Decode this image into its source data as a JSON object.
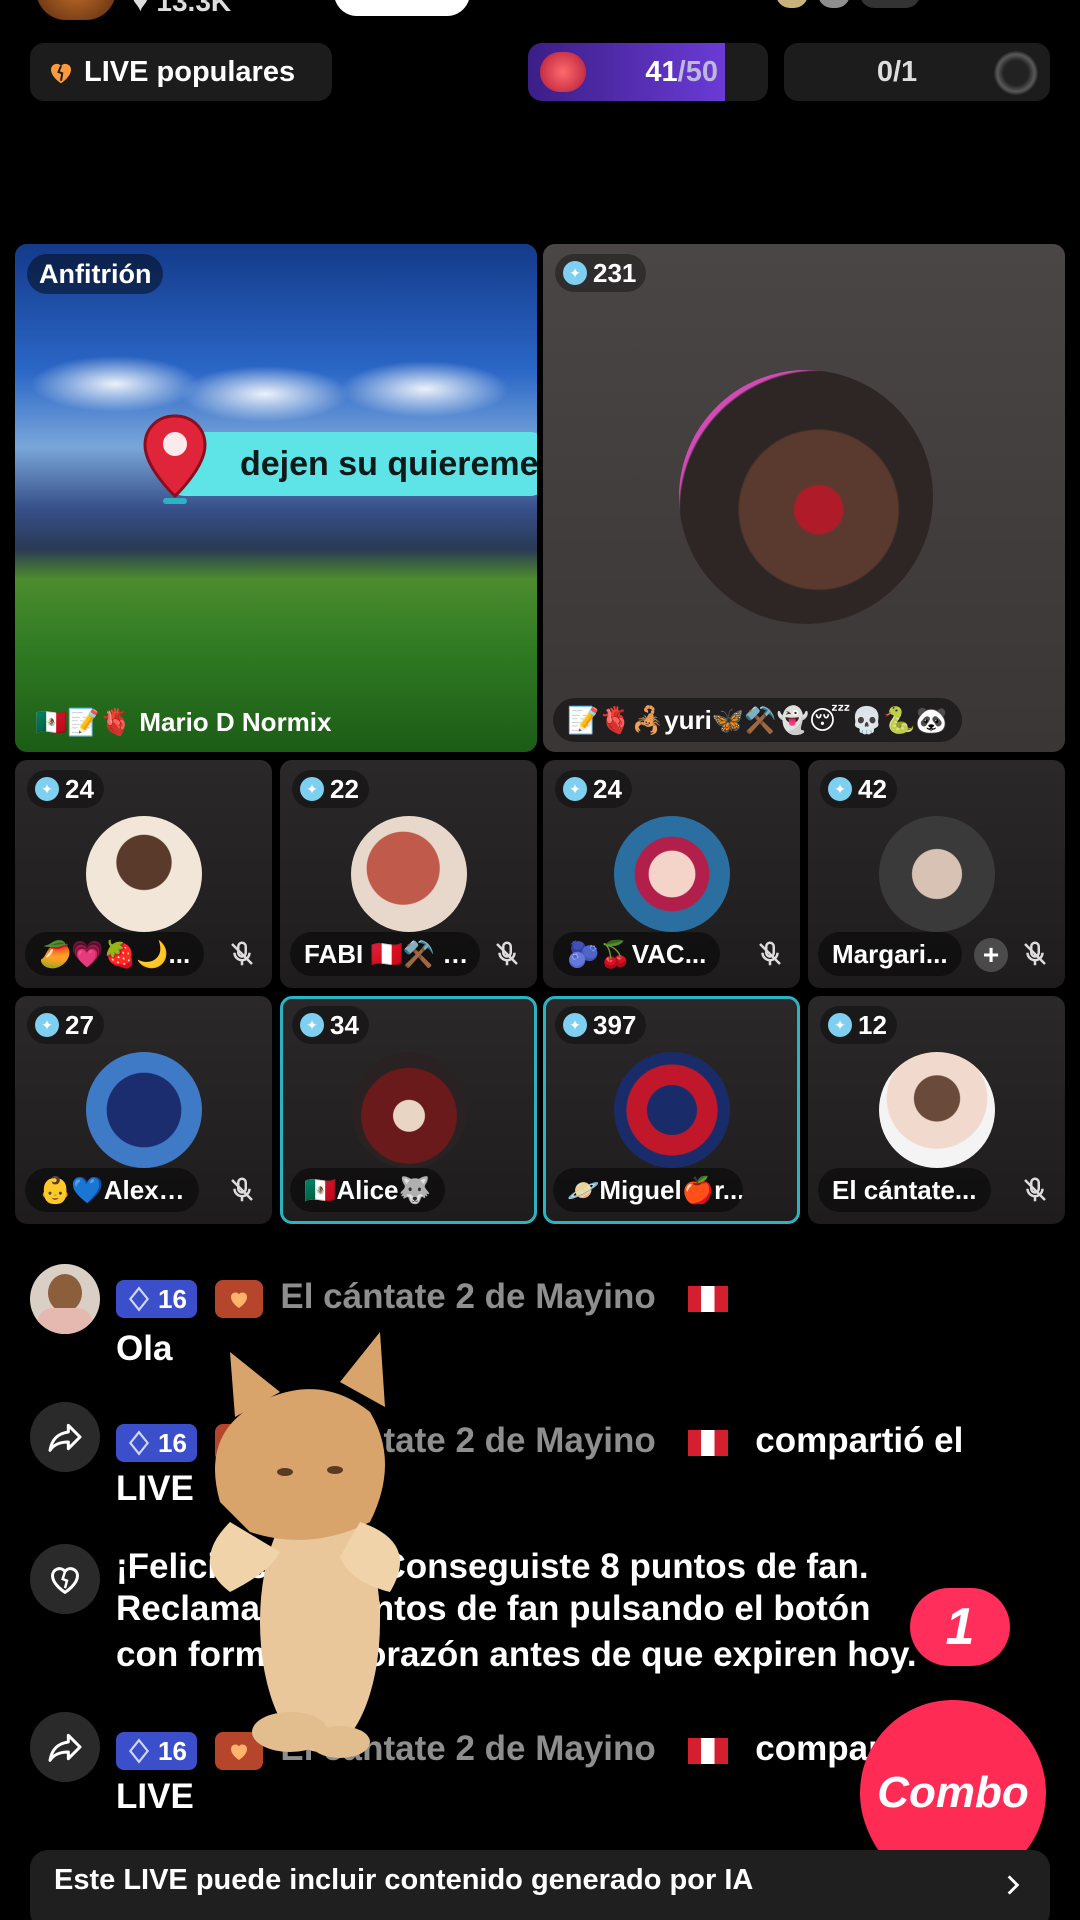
{
  "top": {
    "likes": "13.3K"
  },
  "chips": {
    "live_label": "LIVE populares",
    "score_current": "41",
    "score_total": "/50",
    "score_fraction": 0.82,
    "quest": "0/1"
  },
  "host": {
    "tag": "Anfitrión",
    "banner": "dejen su quiereme",
    "name": "🇲🇽📝🫀 Mario D Normix"
  },
  "feature": {
    "count": "231",
    "name": "📝🫀🦂yuri🦋⚒️👻😴💀🐍🐼"
  },
  "guests": [
    {
      "count": "24",
      "name": "🥭💗🍓🌙...",
      "muted": true
    },
    {
      "count": "22",
      "name": "FABI 🇵🇪⚒️ …",
      "muted": true
    },
    {
      "count": "24",
      "name": "🫐🍒VAC...",
      "muted": true
    },
    {
      "count": "42",
      "name": "Margari...",
      "muted": true,
      "add": true
    },
    {
      "count": "27",
      "name": "👶💙Alex…",
      "muted": true
    },
    {
      "count": "34",
      "name": "🇲🇽Alice🐺",
      "muted": false
    },
    {
      "count": "397",
      "name": "🪐Miguel🍎r...",
      "muted": false
    },
    {
      "count": "12",
      "name": "El cántate...",
      "muted": true
    }
  ],
  "chat": {
    "msg1": {
      "level": "16",
      "user": "El cántate 2 de Mayino",
      "text": "Ola"
    },
    "msg2": {
      "level": "16",
      "user": "El cántate 2 de Mayino",
      "action": "compartió el",
      "cont": "LIVE"
    },
    "msg3": {
      "line1": "¡Felicitaciones! Conseguiste 8 puntos de fan.",
      "line2": "Reclama los puntos de fan pulsando el botón",
      "line3": "con forma de corazón antes de que expiren hoy."
    },
    "msg4": {
      "level": "16",
      "user": "El cántate 2 de Mayino",
      "action": "compartió el",
      "cont": "LIVE"
    }
  },
  "combo": {
    "count": "1",
    "label": "Combo"
  },
  "ai_notice": "Este LIVE puede incluir contenido generado por IA",
  "colors": {
    "accent": "#fe2c55",
    "teal": "#5ee3e6",
    "level": "#3a4fc9"
  }
}
